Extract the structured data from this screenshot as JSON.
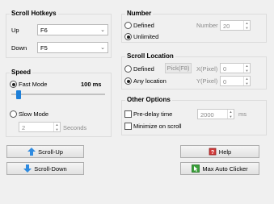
{
  "scroll_hotkeys": {
    "title": "Scroll Hotkeys",
    "up_label": "Up",
    "up_value": "F6",
    "down_label": "Down",
    "down_value": "F5"
  },
  "speed": {
    "title": "Speed",
    "fast_mode_label": "Fast Mode",
    "fast_value": "100 ms",
    "slider_fraction": 0.05,
    "slow_mode_label": "Slow Mode",
    "slow_value": "2",
    "slow_unit": "Seconds"
  },
  "number": {
    "title": "Number",
    "defined_label": "Defined",
    "number_label": "Number",
    "number_value": "20",
    "unlimited_label": "Unlimited"
  },
  "scroll_location": {
    "title": "Scroll Location",
    "defined_label": "Defined",
    "pick_label": "Pick(F8)",
    "x_label": "X(Pixel)",
    "x_value": "0",
    "any_label": "Any location",
    "y_label": "Y(Pixel)",
    "y_value": "0"
  },
  "other_options": {
    "title": "Other Options",
    "predelay_label": "Pre-delay time",
    "predelay_value": "2000",
    "predelay_unit": "ms",
    "minimize_label": "Minimize on scroll"
  },
  "buttons": {
    "scroll_up": "Scroll-Up",
    "scroll_down": "Scroll-Down",
    "help": "Help",
    "max_auto_clicker": "Max Auto Clicker"
  },
  "colors": {
    "accent": "#1e7fd8",
    "arrow_blue": "#2f8be0"
  },
  "icons": {
    "scroll_up": "arrow-up-icon",
    "scroll_down": "arrow-down-icon",
    "help": "help-icon",
    "max_auto_clicker": "auto-clicker-icon"
  }
}
